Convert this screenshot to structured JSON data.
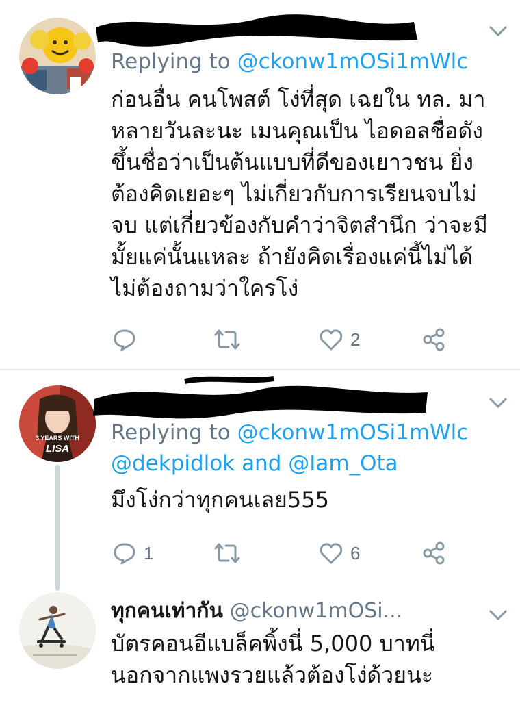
{
  "tweets": [
    {
      "replying_label": "Replying to",
      "replying_to": "@ckonw1mOSi1mWlc",
      "text": "ก่อนอื่น คนโพสต์ โง่ที่สุด เฉยใน ทล. มา\nหลายวันละนะ เมนคุณเป็น ไอดอลชื่อดัง\nขึ้นชื่อว่าเป็นต้นแบบที่ดีของเยาวชน ยิ่ง\nต้องคิดเยอะๆ ไม่เกี่ยวกับการเรียนจบไม่\nจบ แต่เกี่ยวข้องกับคำว่าจิตสำนึก ว่าจะมี\nมั้ยแค่นั้นแหละ  ถ้ายังคิดเรื่องแค่นี้ไม่ได้\nไม่ต้องถามว่าใครโง่",
      "replies": "",
      "likes": "2"
    },
    {
      "replying_label": "Replying to",
      "replying_to": "@ckonw1mOSi1mWlc",
      "also": "@dekpidlok",
      "and_label": "and",
      "also2": "@Iam_Ota",
      "avatar_caption": "3 YEARS WITH",
      "avatar_name": "LISA",
      "text": "มึงโง่กว่าทุกคนเลย555",
      "replies": "1",
      "likes": "6"
    },
    {
      "display_name": "ทุกคนเท่ากัน",
      "handle": "@ckonw1mOSi...",
      "text": "บัตรคอนอีแบล็คพิ้งนี่ 5,000 บาทนี่\nนอกจากแพงรวยแล้วต้องโง่ด้วยนะ"
    }
  ],
  "icons": {
    "reply": "reply-bubble-icon",
    "retweet": "retweet-icon",
    "like": "heart-icon",
    "share": "share-icon",
    "menu": "chevron-down-icon"
  },
  "colors": {
    "link": "#1da1f2",
    "secondary": "#657786",
    "divider": "#e6ecf0",
    "thread": "#ccd6dd"
  }
}
